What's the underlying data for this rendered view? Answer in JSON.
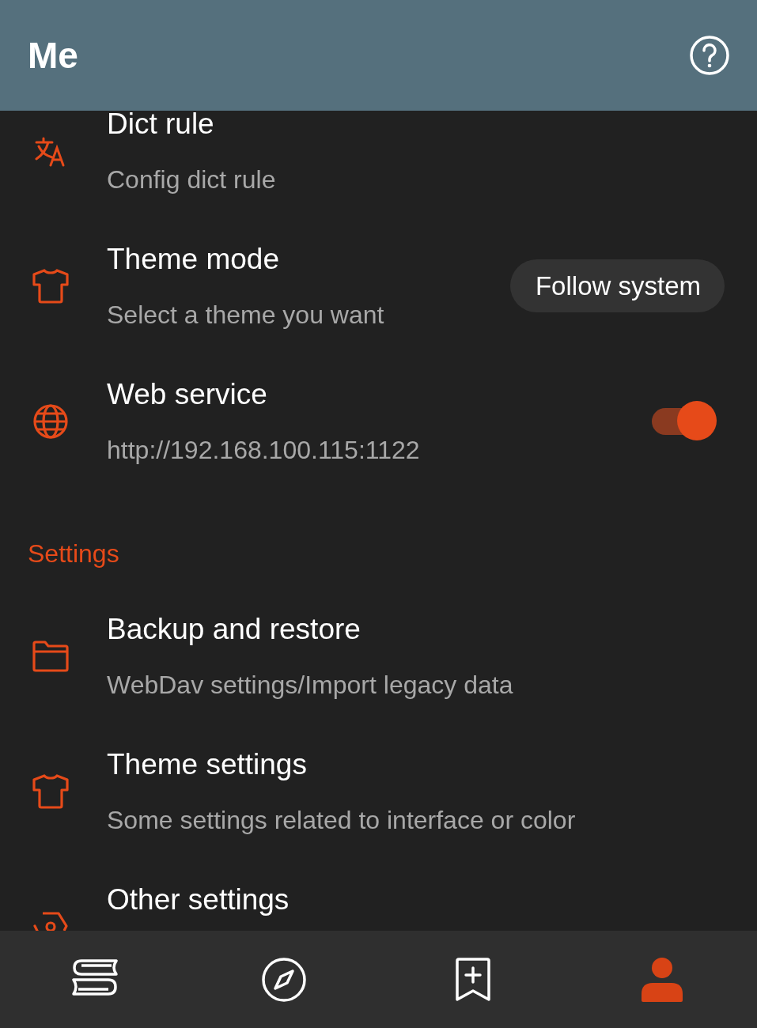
{
  "app_bar": {
    "title": "Me"
  },
  "rows": [
    {
      "kind": "item",
      "title": "Dict rule",
      "subtitle": "Config dict rule"
    },
    {
      "kind": "chip",
      "title": "Theme mode",
      "subtitle": "Select a theme you want",
      "value": "Follow system"
    },
    {
      "kind": "switch",
      "title": "Web service",
      "subtitle": "http://192.168.100.115:1122",
      "on": true
    },
    {
      "kind": "header",
      "title": "Settings"
    },
    {
      "kind": "item",
      "title": "Backup and restore",
      "subtitle": "WebDav settings/Import legacy data"
    },
    {
      "kind": "item",
      "title": "Theme settings",
      "subtitle": "Some settings related to interface or color"
    },
    {
      "kind": "item",
      "title": "Other settings"
    }
  ],
  "nav": [
    {
      "selected": false
    },
    {
      "selected": false
    },
    {
      "selected": false
    },
    {
      "selected": true
    }
  ]
}
